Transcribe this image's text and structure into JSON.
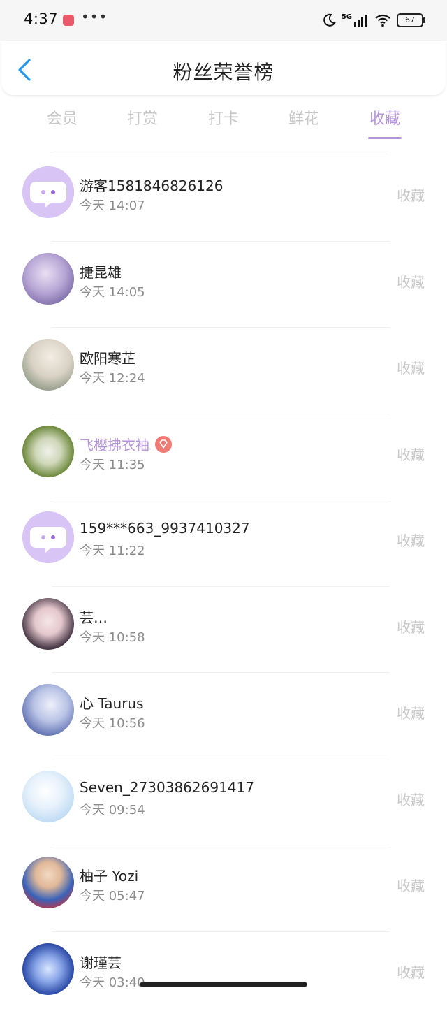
{
  "status_bar": {
    "time": "4:37",
    "dots": "•••",
    "network": "5G",
    "battery": "67"
  },
  "header": {
    "title": "粉丝荣誉榜"
  },
  "tabs": [
    {
      "label": "会员"
    },
    {
      "label": "打赏"
    },
    {
      "label": "打卡"
    },
    {
      "label": "鲜花"
    },
    {
      "label": "收藏"
    }
  ],
  "active_tab": "收藏",
  "fans": [
    {
      "name": "游客1581846826126",
      "time": "今天 14:07",
      "action": "收藏"
    },
    {
      "name": "捷昆雄",
      "time": "今天 14:05",
      "action": "收藏"
    },
    {
      "name": "欧阳寒芷",
      "time": "今天 12:24",
      "action": "收藏"
    },
    {
      "name": "飞樱拂衣袖",
      "time": "今天 11:35",
      "action": "收藏"
    },
    {
      "name": "159***663_9937410327",
      "time": "今天 11:22",
      "action": "收藏"
    },
    {
      "name": "芸…",
      "time": "今天 10:58",
      "action": "收藏"
    },
    {
      "name": "心 Taurus",
      "time": "今天 10:56",
      "action": "收藏"
    },
    {
      "name": "Seven_27303862691417",
      "time": "今天 09:54",
      "action": "收藏"
    },
    {
      "name": "柚子 Yozi",
      "time": "今天 05:47",
      "action": "收藏"
    },
    {
      "name": "谢瑾芸",
      "time": "今天 03:40",
      "action": "收藏"
    }
  ],
  "colors": {
    "accent": "#b594de",
    "inactive_tab": "#c6c6c6",
    "secondary_text": "#8c8c8c",
    "action_text": "#c9c9c9",
    "back_arrow": "#2196f3",
    "vip_badge": "#f07a74"
  }
}
